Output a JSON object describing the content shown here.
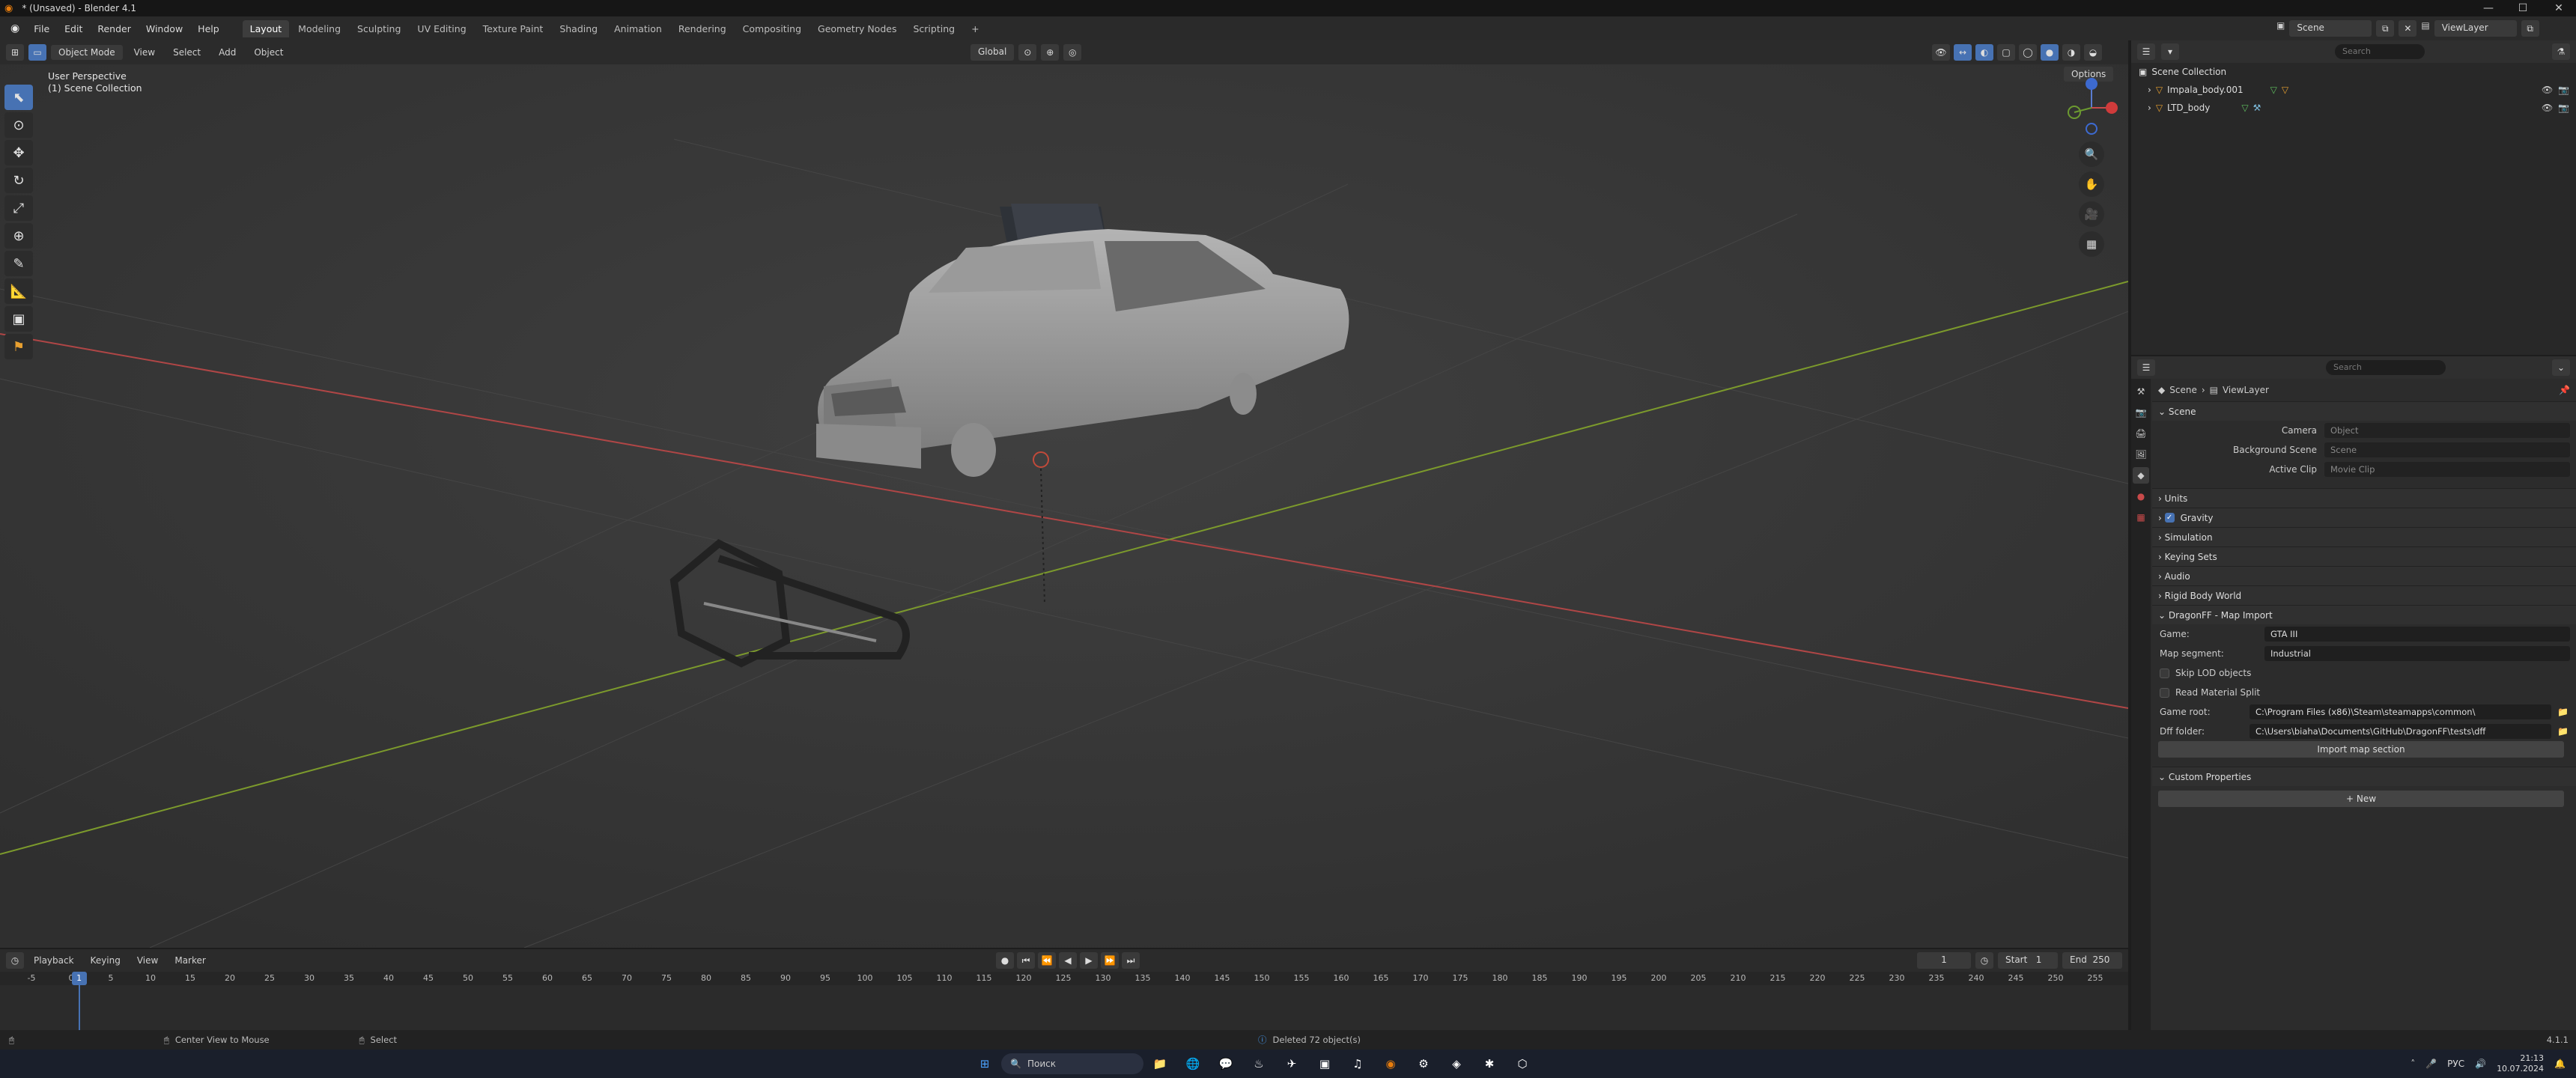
{
  "window": {
    "title": "* (Unsaved) - Blender 4.1",
    "minimize": "—",
    "maximize": "☐",
    "close": "✕"
  },
  "menu": [
    "File",
    "Edit",
    "Render",
    "Window",
    "Help"
  ],
  "workspaces": [
    "Layout",
    "Modeling",
    "Sculpting",
    "UV Editing",
    "Texture Paint",
    "Shading",
    "Animation",
    "Rendering",
    "Compositing",
    "Geometry Nodes",
    "Scripting"
  ],
  "scene_field": "Scene",
  "viewlayer_field": "ViewLayer",
  "view_header": {
    "mode": "Object Mode",
    "menus": [
      "View",
      "Select",
      "Add",
      "Object"
    ],
    "orientation": "Global",
    "options": "Options"
  },
  "viewport": {
    "perspective": "User Perspective",
    "collection": "(1) Scene Collection",
    "colors": {
      "x_axis": "#b04646",
      "y_axis": "#7c9a2c",
      "bg": "#3a3a3a"
    }
  },
  "outliner": {
    "search_placeholder": "Search",
    "root": "Scene Collection",
    "items": [
      "Impala_body.001",
      "LTD_body"
    ]
  },
  "properties": {
    "search_placeholder": "Search",
    "breadcrumb": [
      "Scene",
      "ViewLayer"
    ],
    "scene_section": "Scene",
    "camera_label": "Camera",
    "camera_value": "Object",
    "bg_scene_label": "Background Scene",
    "bg_scene_value": "Scene",
    "clip_label": "Active Clip",
    "clip_value": "Movie Clip",
    "sections": [
      "Units",
      "Gravity",
      "Simulation",
      "Keying Sets",
      "Audio",
      "Rigid Body World"
    ],
    "dragonff": {
      "title": "DragonFF - Map Import",
      "game_label": "Game:",
      "game_value": "GTA III",
      "segment_label": "Map segment:",
      "segment_value": "Industrial",
      "skip_lod": "Skip LOD objects",
      "read_material": "Read Material Split",
      "game_root_label": "Game root:",
      "game_root_value": "C:\\Program Files (x86)\\Steam\\steamapps\\common\\",
      "dff_label": "Dff folder:",
      "dff_value": "C:\\Users\\biaha\\Documents\\GitHub\\DragonFF\\tests\\dff",
      "import_btn": "Import map section"
    },
    "custom_props": "Custom Properties",
    "new_btn": "New"
  },
  "timeline": {
    "menus": [
      "Playback",
      "Keying",
      "View",
      "Marker"
    ],
    "current_frame": "1",
    "start_label": "Start",
    "start": "1",
    "end_label": "End",
    "end": "250",
    "ticks": [
      "-5",
      "0",
      "5",
      "10",
      "15",
      "20",
      "25",
      "30",
      "35",
      "40",
      "45",
      "50",
      "55",
      "60",
      "65",
      "70",
      "75",
      "80",
      "85",
      "90",
      "95",
      "100",
      "105",
      "110",
      "115",
      "120",
      "125",
      "130",
      "135",
      "140",
      "145",
      "150",
      "155",
      "160",
      "165",
      "170",
      "175",
      "180",
      "185",
      "190",
      "195",
      "200",
      "205",
      "210",
      "215",
      "220",
      "225",
      "230",
      "235",
      "240",
      "245",
      "250",
      "255"
    ],
    "cursor_frame": 1
  },
  "status": {
    "hint1": "Center View to Mouse",
    "hint2": "Select",
    "message": "Deleted 72 object(s)",
    "version": "4.1.1"
  },
  "taskbar": {
    "search": "Поиск",
    "lang": "РУС",
    "time": "21:13",
    "date": "10.07.2024"
  }
}
